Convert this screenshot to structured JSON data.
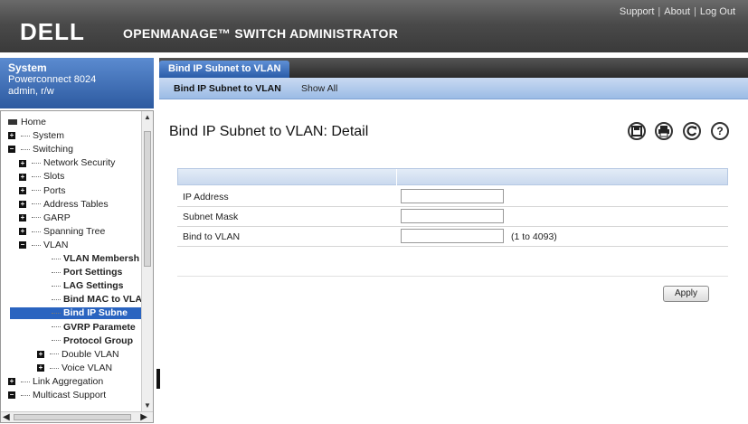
{
  "header": {
    "logo": "DELL",
    "product_title": "OPENMANAGE™ SWITCH ADMINISTRATOR",
    "links": [
      "Support",
      "About",
      "Log Out"
    ]
  },
  "system_box": {
    "title": "System",
    "model": "Powerconnect 8024",
    "user": "admin, r/w"
  },
  "tree": [
    {
      "label": "Home",
      "expander": null
    },
    {
      "label": "System",
      "expander": "+"
    },
    {
      "label": "Switching",
      "expander": "-"
    },
    {
      "label": "Network Security",
      "expander": "+"
    },
    {
      "label": "Slots",
      "expander": "+"
    },
    {
      "label": "Ports",
      "expander": "+"
    },
    {
      "label": "Address Tables",
      "expander": "+"
    },
    {
      "label": "GARP",
      "expander": "+"
    },
    {
      "label": "Spanning Tree",
      "expander": "+"
    },
    {
      "label": "VLAN",
      "expander": "-"
    },
    {
      "label": "VLAN Membersh",
      "expander": null
    },
    {
      "label": "Port Settings",
      "expander": null
    },
    {
      "label": "LAG Settings",
      "expander": null
    },
    {
      "label": "Bind MAC to VLA",
      "expander": null
    },
    {
      "label": "Bind IP Subne",
      "expander": null,
      "selected": true
    },
    {
      "label": "GVRP Paramete",
      "expander": null
    },
    {
      "label": "Protocol Group",
      "expander": null
    },
    {
      "label": "Double VLAN",
      "expander": "+"
    },
    {
      "label": "Voice VLAN",
      "expander": "+"
    },
    {
      "label": "Link Aggregation",
      "expander": "+"
    },
    {
      "label": "Multicast Support",
      "expander": "-"
    }
  ],
  "tabs": {
    "main": "Bind IP Subnet to VLAN",
    "sub": [
      "Bind IP Subnet to VLAN",
      "Show All"
    ]
  },
  "main": {
    "title": "Bind IP Subnet to VLAN: Detail",
    "toolbar_icons": [
      "save-icon",
      "print-icon",
      "refresh-icon",
      "help-icon"
    ],
    "fields": [
      {
        "label": "IP Address",
        "value": "",
        "hint": ""
      },
      {
        "label": "Subnet Mask",
        "value": "",
        "hint": ""
      },
      {
        "label": "Bind to VLAN",
        "value": "",
        "hint": "(1 to 4093)"
      }
    ],
    "apply_label": "Apply"
  }
}
